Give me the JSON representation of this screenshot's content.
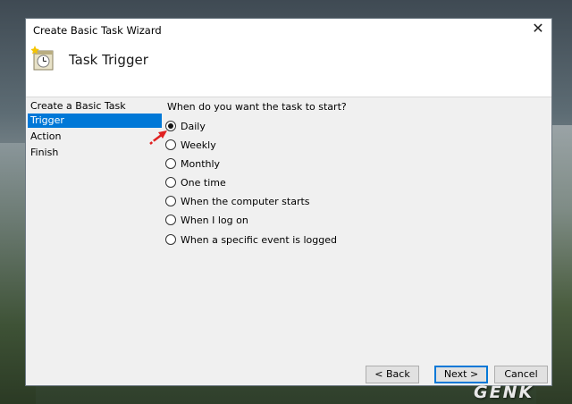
{
  "window": {
    "title": "Create Basic Task Wizard",
    "close_symbol": "✕"
  },
  "header": {
    "title": "Task Trigger",
    "icon": "clock-task-icon"
  },
  "nav": {
    "items": [
      {
        "label": "Create a Basic Task",
        "selected": false
      },
      {
        "label": "Trigger",
        "selected": true
      },
      {
        "label": "Action",
        "selected": false
      },
      {
        "label": "Finish",
        "selected": false
      }
    ]
  },
  "trigger": {
    "question": "When do you want the task to start?",
    "options": [
      {
        "label": "Daily",
        "checked": true
      },
      {
        "label": "Weekly",
        "checked": false
      },
      {
        "label": "Monthly",
        "checked": false
      },
      {
        "label": "One time",
        "checked": false
      },
      {
        "label": "When the computer starts",
        "checked": false
      },
      {
        "label": "When I log on",
        "checked": false
      },
      {
        "label": "When a specific event is logged",
        "checked": false
      }
    ]
  },
  "buttons": {
    "back": "< Back",
    "next": "Next >",
    "cancel": "Cancel"
  },
  "watermark": {
    "text": "GENK"
  },
  "colors": {
    "selection": "#0078d7",
    "annotation_arrow": "#e02020"
  }
}
